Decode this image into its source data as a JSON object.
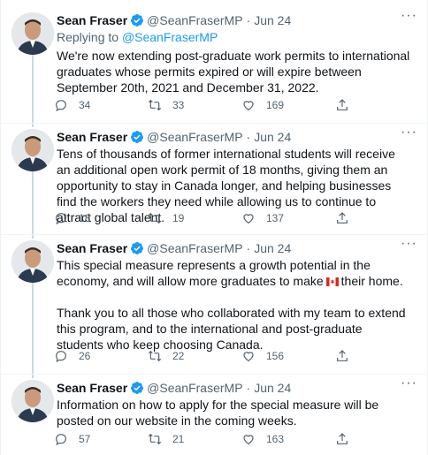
{
  "author": {
    "name": "Sean Fraser",
    "handle": "@SeanFraserMP",
    "dot": "·",
    "date": "Jun 24"
  },
  "tweets": [
    {
      "replying_prefix": "Replying to ",
      "replying_handle": "@SeanFraserMP",
      "text": "We're now extending post-graduate work permits to international graduates whose permits expired or will expire between September 20th, 2021 and December 31, 2022.",
      "replies": "34",
      "retweets": "33",
      "likes": "169"
    },
    {
      "text": "Tens of thousands of former international students will receive an additional open work permit of 18 months, giving them an opportunity to stay in Canada longer, and helping businesses find the workers they need while allowing us to continue to attract global talent.",
      "replies": "18",
      "retweets": "19",
      "likes": "137"
    },
    {
      "text_a": "This special measure represents a growth potential in the",
      "text_b": "economy, and will allow more graduates to make",
      "text_c": "their home.",
      "text_2": "Thank you to all those who collaborated with my team to extend this program, and to the international and post-graduate students who keep choosing Canada.",
      "replies": "26",
      "retweets": "22",
      "likes": "156"
    },
    {
      "text": "Information on how to apply for the special measure will be posted on our website in the coming weeks.",
      "replies": "57",
      "retweets": "21",
      "likes": "163"
    }
  ],
  "colors": {
    "text": "#0f1419",
    "secondary": "#536471",
    "link": "#1d9bf0",
    "verified": "#1d9bf0",
    "border": "#eff3f4",
    "thread_line": "#cfd9de"
  },
  "icons": [
    "verified-badge-icon",
    "more-icon",
    "reply-icon",
    "retweet-icon",
    "like-icon",
    "share-icon",
    "canada-flag-icon"
  ]
}
